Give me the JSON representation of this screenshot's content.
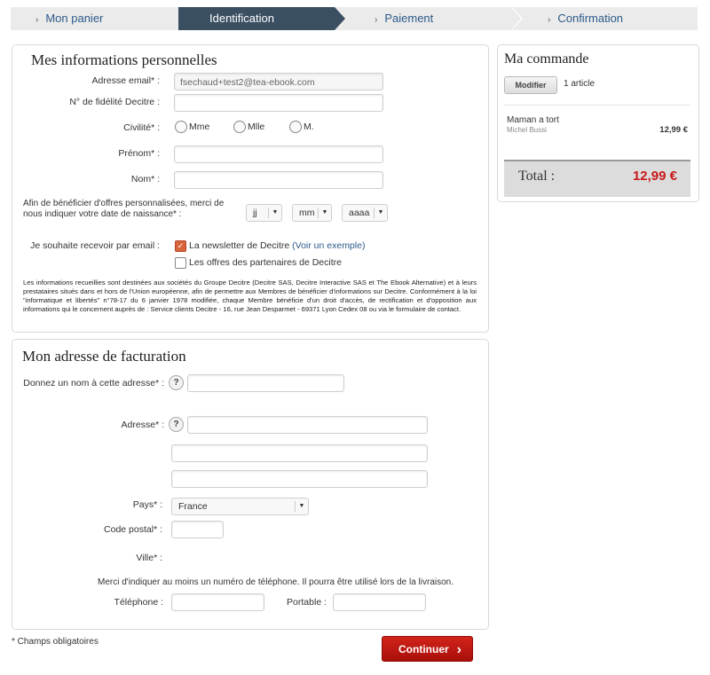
{
  "steps": [
    {
      "label": "Mon panier"
    },
    {
      "label": "Identification"
    },
    {
      "label": "Paiement"
    },
    {
      "label": "Confirmation"
    }
  ],
  "personal": {
    "title": "Mes informations personnelles",
    "email_label": "Adresse email* :",
    "email_value": "fsechaud+test2@tea-ebook.com",
    "loyalty_label": "N° de fidélité Decitre :",
    "civility_label": "Civilité* :",
    "civility_options": [
      "Mme",
      "Mlle",
      "M."
    ],
    "firstname_label": "Prénom* :",
    "lastname_label": "Nom* :",
    "birth_label": "Afin de bénéficier d'offres personnalisées, merci de nous indiquer votre date de naissance* :",
    "birth_day": "jj",
    "birth_month": "mm",
    "birth_year": "aaaa",
    "newsletter_label": "Je souhaite recevoir par email :",
    "newsletter_option": "La newsletter de Decitre",
    "newsletter_link": "(Voir un exemple)",
    "partners_option": "Les offres des partenaires de Decitre",
    "legal": "Les informations recueillies sont destinées aux sociétés du Groupe Decitre (Decitre SAS, Decitre Interactive SAS et The Ebook Alternative) et à leurs prestataires situés dans et hors de l'Union européenne, afin de permettre aux Membres de bénéficier d'informations sur Decitre. Conformément à la loi \"informatique et libertés\" n°78-17 du 6 janvier 1978 modifiée, chaque Membre bénéficie d'un droit d'accès, de rectification et d'opposition aux informations qui le concernent auprès de : Service clients Decitre - 16, rue Jean Desparmet - 69371 Lyon Cedex 08 ou via le formulaire de contact."
  },
  "billing": {
    "title": "Mon adresse de facturation",
    "name_label": "Donnez un nom à cette adresse* :",
    "address_label": "Adresse* :",
    "country_label": "Pays* :",
    "country_value": "France",
    "postal_label": "Code postal* :",
    "city_label": "Ville* :",
    "phone_note": "Merci d'indiquer au moins un numéro de téléphone. Il pourra être utilisé lors de la livraison.",
    "phone_label": "Téléphone :",
    "mobile_label": "Portable :",
    "help": "?"
  },
  "order": {
    "title": "Ma commande",
    "modify_label": "Modifier",
    "count": "1 article",
    "item_title": "Maman a tort",
    "item_author": "Michel Bussi",
    "item_price": "12,99 €",
    "total_label": "Total :",
    "total_value": "12,99 €"
  },
  "footer": {
    "required_note": "* Champs obligatoires",
    "continue_label": "Continuer"
  },
  "colors": {
    "accent": "#c8191a",
    "active_step": "#3b4f62",
    "link": "#2d5a8a"
  }
}
